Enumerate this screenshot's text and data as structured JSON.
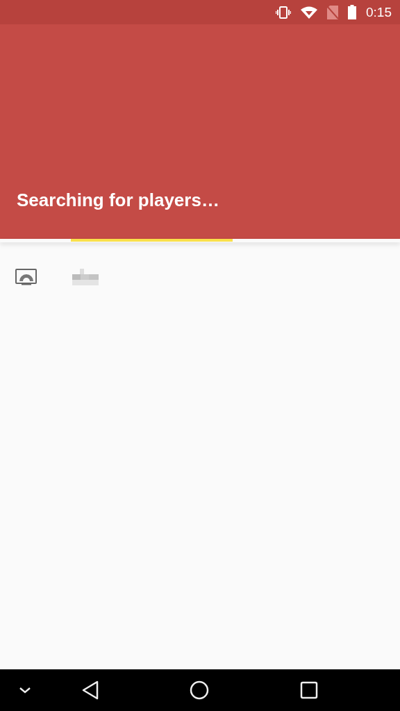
{
  "status_bar": {
    "time": "0:15"
  },
  "header": {
    "title": "Searching for players…"
  },
  "players": [
    {
      "kind": "cast"
    }
  ]
}
